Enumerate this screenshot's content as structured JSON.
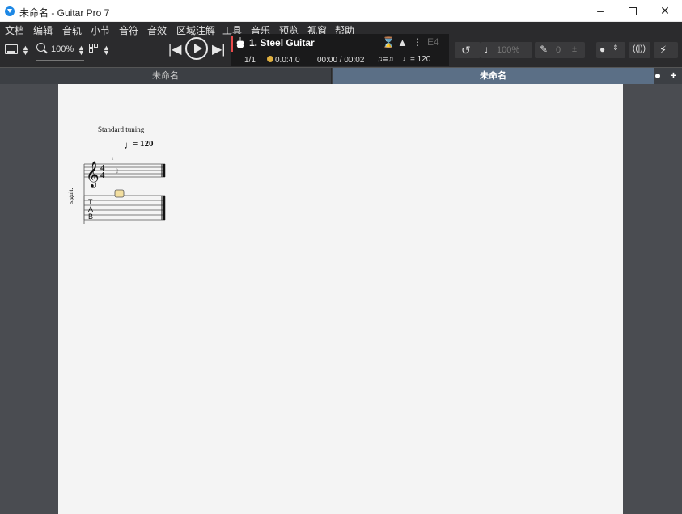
{
  "window": {
    "title": "未命名 - Guitar Pro 7",
    "minimize": "–",
    "close": "✕"
  },
  "menu": [
    "文档",
    "编辑",
    "音轨",
    "小节",
    "音符",
    "音效",
    "区域注解",
    "工具",
    "音乐",
    "预览",
    "视窗",
    "帮助"
  ],
  "toolbar": {
    "zoom": "100%",
    "prev": "|◀",
    "next": "▶|"
  },
  "display": {
    "track_name": "1. Steel Guitar",
    "bar_position": "1/1",
    "beat_position": "0.0:4.0",
    "time": "00:00 / 00:02",
    "triplet_feel": "♫=♫",
    "tempo": "♩= 120",
    "key": "E4"
  },
  "right_tools": {
    "volume": "100%",
    "pan": "0",
    "plus_minus": "±"
  },
  "tabs": [
    {
      "label": "未命名",
      "active": false
    },
    {
      "label": "未命名",
      "active": true
    }
  ],
  "tab_add": "+",
  "score": {
    "tuning": "Standard tuning",
    "tempo_note": "♩",
    "tempo": "= 120",
    "track_label": "s.guit.",
    "time_signature": [
      "4",
      "4"
    ],
    "tab_letters": [
      "T",
      "A",
      "B"
    ],
    "bar_number": "1"
  },
  "colors": {
    "toolbar_bg": "#2b2b2d",
    "active_tab": "#5b6f86",
    "workspace_bg": "#4a4c51",
    "page_bg": "#f4f4f4",
    "track_marker": "#e94a4a",
    "cursor": "#f3dfa0"
  }
}
